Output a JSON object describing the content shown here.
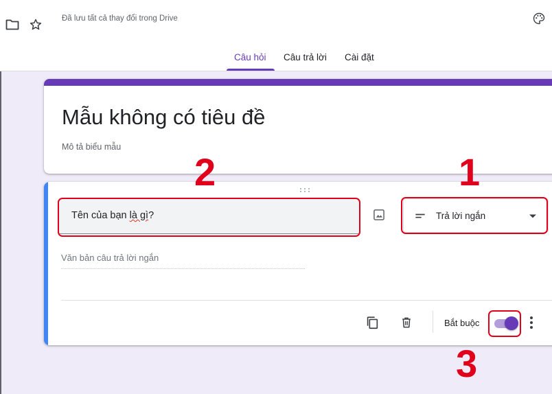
{
  "header": {
    "save_status": "Đã lưu tất cả thay đổi trong Drive",
    "tabs": [
      {
        "label": "Câu hỏi",
        "active": true
      },
      {
        "label": "Câu trả lời",
        "active": false
      },
      {
        "label": "Cài đặt",
        "active": false
      }
    ],
    "icons": [
      "folder-icon",
      "star-icon",
      "palette-icon"
    ]
  },
  "form": {
    "title": "Mẫu không có tiêu đề",
    "description": "Mô tả biểu mẫu"
  },
  "question": {
    "text_before": "Tên của bạn ",
    "text_misspelled": "là gì",
    "text_after": "?",
    "type_label": "Trả lời ngắn",
    "answer_placeholder": "Văn bản câu trả lời ngắn",
    "required_label": "Bắt buộc",
    "required_on": true
  },
  "annotations": [
    "1",
    "2",
    "3"
  ],
  "colors": {
    "accent": "#673ab7",
    "question_highlight": "#4285f4",
    "annotation": "#e0001b",
    "background": "#f0ebf8"
  }
}
